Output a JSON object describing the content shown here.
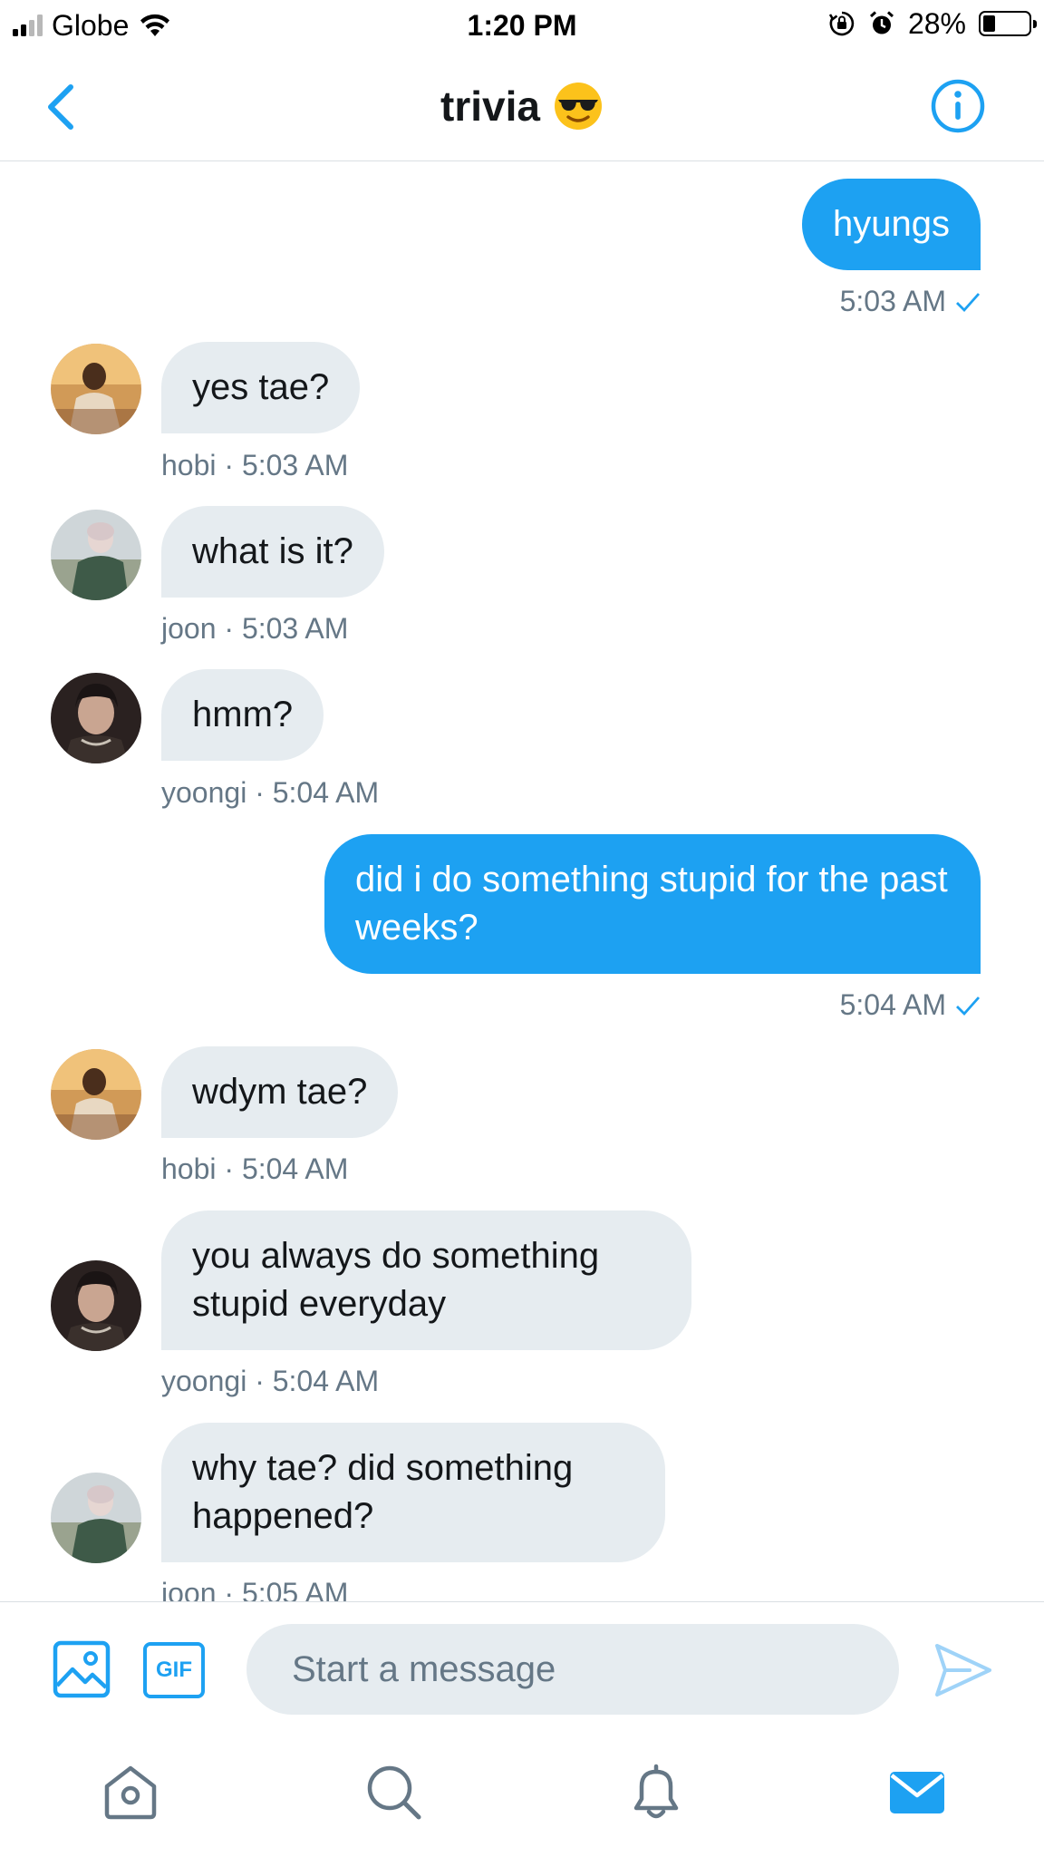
{
  "status_bar": {
    "carrier": "Globe",
    "time": "1:20 PM",
    "battery_percent": "28%",
    "battery_level": 0.28,
    "icons": [
      "signal-icon",
      "wifi-icon",
      "orientation-lock-icon",
      "alarm-icon",
      "battery-icon"
    ]
  },
  "header": {
    "title": "trivia",
    "title_emoji": "smiling-face-with-sunglasses",
    "back_icon": "chevron-left-icon",
    "info_icon": "info-icon"
  },
  "messages": [
    {
      "direction": "outgoing",
      "text": "hyungs",
      "time": "5:03 AM"
    },
    {
      "direction": "incoming",
      "sender": "hobi",
      "text": "yes tae?",
      "meta": "hobi · 5:03 AM"
    },
    {
      "direction": "incoming",
      "sender": "joon",
      "text": "what is it?",
      "meta": "joon · 5:03 AM"
    },
    {
      "direction": "incoming",
      "sender": "yoongi",
      "text": "hmm?",
      "meta": "yoongi · 5:04 AM"
    },
    {
      "direction": "outgoing",
      "text": "did i do something stupid for the past weeks?",
      "time": "5:04 AM"
    },
    {
      "direction": "incoming",
      "sender": "hobi",
      "text": "wdym tae?",
      "meta": "hobi · 5:04 AM"
    },
    {
      "direction": "incoming",
      "sender": "yoongi",
      "text": "you always do something stupid everyday",
      "meta": "yoongi · 5:04 AM"
    },
    {
      "direction": "incoming",
      "sender": "joon",
      "text": "why tae? did something happened?",
      "meta": "joon · 5:05 AM"
    }
  ],
  "composer": {
    "placeholder": "Start a message",
    "gif_label": "GIF",
    "media_icon": "image-icon",
    "send_icon": "send-icon"
  },
  "tab_bar": {
    "tabs": [
      "home-icon",
      "search-icon",
      "notifications-icon",
      "messages-icon"
    ],
    "active": "messages-icon"
  },
  "colors": {
    "accent": "#1da1f2",
    "incoming_bubble": "#e6ecf0",
    "meta_text": "#657786",
    "primary_text": "#14171a"
  }
}
